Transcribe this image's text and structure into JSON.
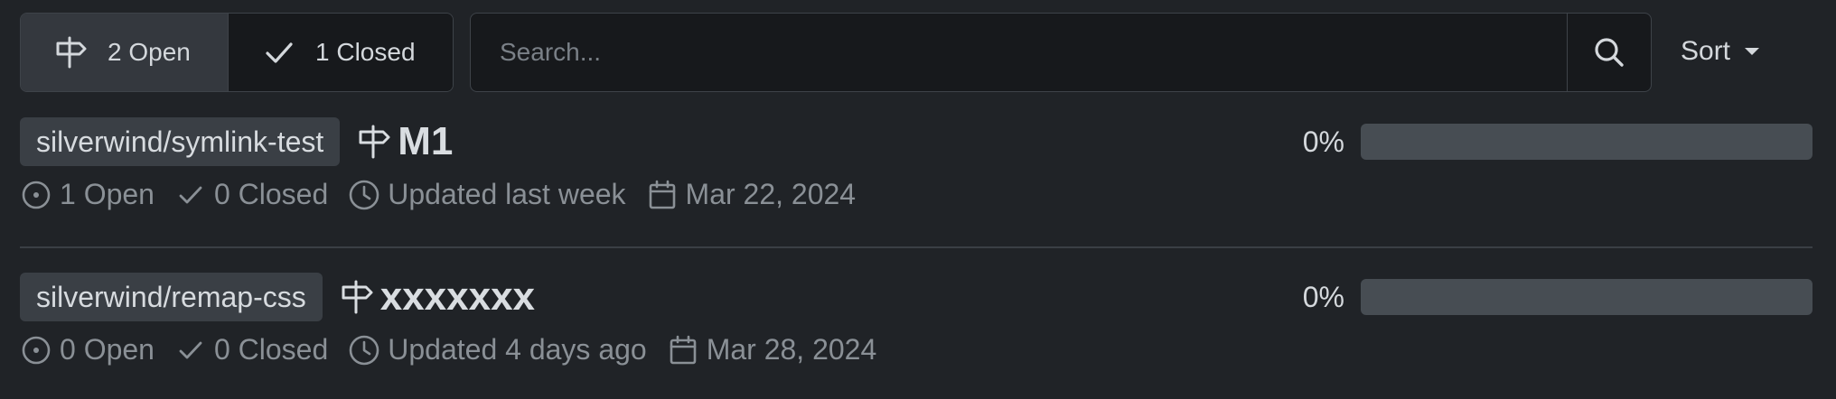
{
  "filters": {
    "open_label": "2 Open",
    "closed_label": "1 Closed"
  },
  "search": {
    "placeholder": "Search...",
    "icon": "search-icon"
  },
  "sort": {
    "label": "Sort"
  },
  "milestones": [
    {
      "repo": "silverwind/symlink-test",
      "title": "M1",
      "progress_label": "0%",
      "progress": 0,
      "open_issues": "1 Open",
      "closed_issues": "0 Closed",
      "updated": "Updated last week",
      "due_date": "Mar 22, 2024"
    },
    {
      "repo": "silverwind/remap-css",
      "title": "xxxxxxx",
      "progress_label": "0%",
      "progress": 0,
      "open_issues": "0 Open",
      "closed_issues": "0 Closed",
      "updated": "Updated 4 days ago",
      "due_date": "Mar 28, 2024"
    }
  ],
  "colors": {
    "background": "#202327",
    "progress_track": "#474d53",
    "progress_fill": "#4caf50",
    "muted_text": "#8a9096"
  }
}
